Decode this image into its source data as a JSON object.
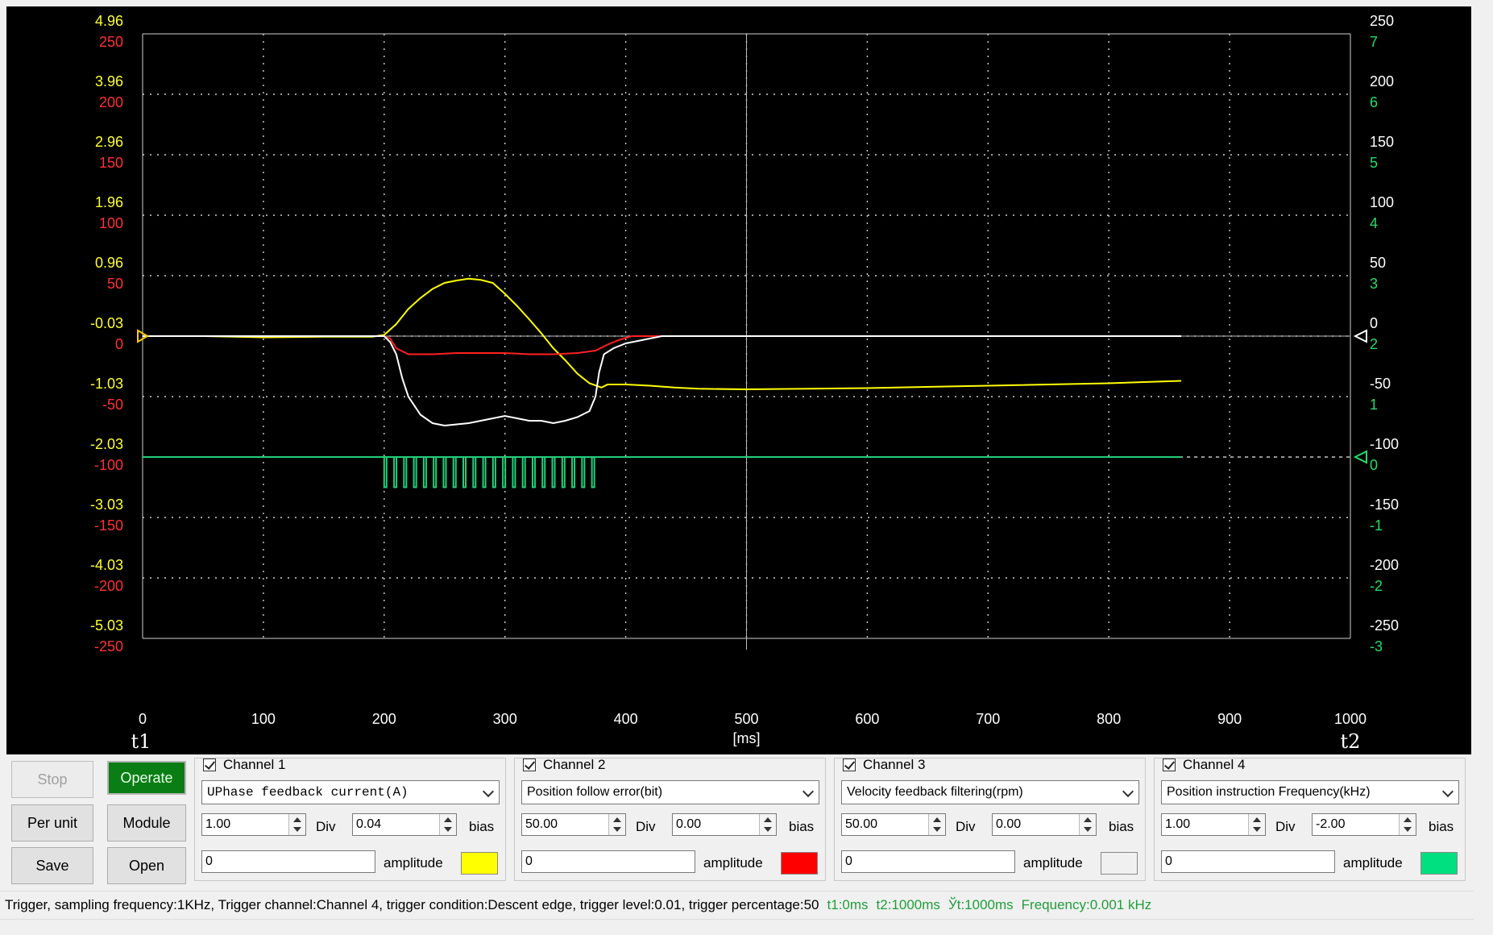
{
  "chart_data": {
    "type": "line",
    "xlabel": "[ms]",
    "x_ticks": [
      0,
      100,
      200,
      300,
      400,
      500,
      600,
      700,
      800,
      900,
      1000
    ],
    "xlim": [
      0,
      1000
    ],
    "cursor_labels": [
      "t1",
      "t2"
    ],
    "left_axis_yellow_ticks": [
      "4.96",
      "3.96",
      "2.96",
      "1.96",
      "0.96",
      "-0.03",
      "-1.03",
      "-2.03",
      "-3.03",
      "-4.03",
      "-5.03"
    ],
    "left_axis_red_ticks": [
      "250",
      "200",
      "150",
      "100",
      "50",
      "0",
      "-50",
      "-100",
      "-150",
      "-200",
      "-250"
    ],
    "right_axis_white_ticks": [
      "250",
      "200",
      "150",
      "100",
      "50",
      "0",
      "-50",
      "-100",
      "-150",
      "-200",
      "-250"
    ],
    "right_axis_green_ticks": [
      "7",
      "6",
      "5",
      "4",
      "3",
      "2",
      "1",
      "0",
      "-1",
      "-2",
      "-3"
    ],
    "grid": true,
    "series": [
      {
        "name": "UPhase feedback current(A)",
        "color": "#ffff00",
        "axis": "yellow",
        "x": [
          0,
          50,
          100,
          150,
          190,
          200,
          210,
          220,
          230,
          240,
          250,
          260,
          270,
          280,
          290,
          300,
          310,
          320,
          330,
          340,
          350,
          360,
          370,
          380,
          385,
          400,
          420,
          440,
          460,
          500,
          600,
          700,
          800,
          860
        ],
        "y": [
          0.0,
          0.0,
          -0.02,
          -0.01,
          -0.01,
          0.02,
          0.2,
          0.45,
          0.63,
          0.78,
          0.88,
          0.92,
          0.95,
          0.93,
          0.88,
          0.7,
          0.5,
          0.28,
          0.05,
          -0.2,
          -0.4,
          -0.62,
          -0.78,
          -0.85,
          -0.8,
          -0.8,
          -0.82,
          -0.85,
          -0.87,
          -0.88,
          -0.86,
          -0.82,
          -0.78,
          -0.74
        ]
      },
      {
        "name": "Position follow error(bit)",
        "color": "#ff2020",
        "axis": "red",
        "x": [
          0,
          200,
          205,
          210,
          220,
          240,
          260,
          280,
          300,
          320,
          340,
          360,
          375,
          385,
          395,
          405,
          860
        ],
        "y": [
          0,
          0,
          -2,
          -10,
          -15,
          -15,
          -14,
          -14,
          -14,
          -15,
          -15,
          -14,
          -12,
          -7,
          -3,
          0,
          0
        ]
      },
      {
        "name": "Velocity feedback filtering(rpm)",
        "color": "#ffffff",
        "axis": "white",
        "x": [
          0,
          200,
          205,
          210,
          215,
          220,
          230,
          240,
          250,
          260,
          270,
          280,
          290,
          300,
          310,
          320,
          330,
          340,
          350,
          360,
          370,
          375,
          378,
          382,
          390,
          395,
          400,
          410,
          420,
          430,
          860
        ],
        "y": [
          0,
          0,
          -5,
          -15,
          -35,
          -50,
          -65,
          -72,
          -74,
          -73,
          -72,
          -70,
          -68,
          -66,
          -68,
          -70,
          -70,
          -72,
          -70,
          -67,
          -62,
          -50,
          -30,
          -15,
          -10,
          -8,
          -6,
          -4,
          -2,
          0,
          0
        ]
      },
      {
        "name": "Position instruction Frequency(kHz)",
        "color": "#22d07a",
        "axis": "green",
        "pulse_train": {
          "start_ms": 200,
          "end_ms": 372,
          "count": 22,
          "baseline": 0,
          "low": -0.5
        },
        "x": [
          0,
          860
        ],
        "y": [
          0,
          0
        ]
      }
    ]
  },
  "buttons": {
    "stop": "Stop",
    "operate": "Operate",
    "per_unit": "Per unit",
    "module": "Module",
    "save": "Save",
    "open": "Open"
  },
  "labels": {
    "div": "Div",
    "bias": "bias",
    "amplitude": "amplitude"
  },
  "channels": [
    {
      "title": "Channel 1",
      "checked": true,
      "signal": "UPhase feedback current(A)",
      "div": "1.00",
      "bias": "0.04",
      "amplitude": "0",
      "color": "#ffff00"
    },
    {
      "title": "Channel 2",
      "checked": true,
      "signal": "Position follow error(bit)",
      "div": "50.00",
      "bias": "0.00",
      "amplitude": "0",
      "color": "#ff0000"
    },
    {
      "title": "Channel 3",
      "checked": true,
      "signal": "Velocity feedback filtering(rpm)",
      "div": "50.00",
      "bias": "0.00",
      "amplitude": "0",
      "color": "#f0f0f0"
    },
    {
      "title": "Channel 4",
      "checked": true,
      "signal": "Position instruction Frequency(kHz)",
      "div": "1.00",
      "bias": "-2.00",
      "amplitude": "0",
      "color": "#00e080"
    }
  ],
  "status": {
    "trigger_text": "Trigger, sampling frequency:1KHz, Trigger channel:Channel 4, trigger condition:Descent edge, trigger level:0.01, trigger percentage:50",
    "t1": "t1:0ms",
    "t2": "t2:1000ms",
    "dt": "Ўt:1000ms",
    "frequency": "Frequency:0.001 kHz"
  }
}
